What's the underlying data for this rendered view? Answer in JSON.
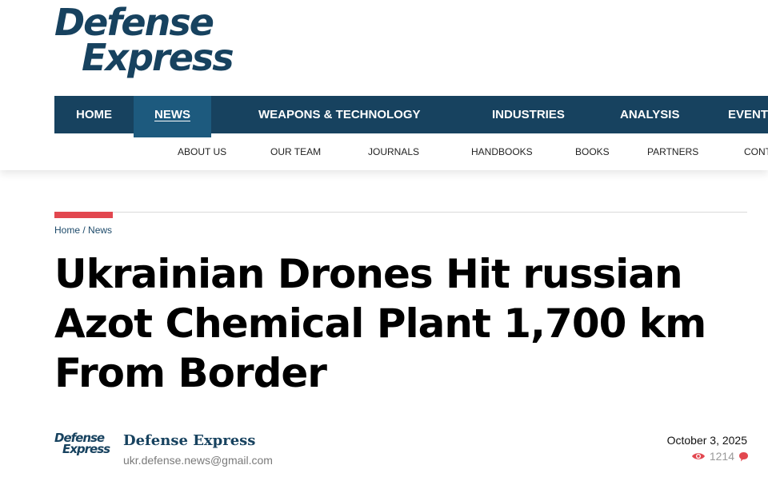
{
  "logo": {
    "line1": "Defense",
    "line2": "Express"
  },
  "main_nav": {
    "items": [
      "HOME",
      "NEWS",
      "WEAPONS & TECHNOLOGY",
      "INDUSTRIES",
      "ANALYSIS",
      "EVENT"
    ],
    "active": "NEWS"
  },
  "sub_nav": {
    "items": [
      "ABOUT US",
      "OUR TEAM",
      "JOURNALS",
      "HANDBOOKS",
      "BOOKS",
      "PARTNERS",
      "CONT"
    ]
  },
  "breadcrumb": {
    "home": "Home",
    "separator": " / ",
    "current": "News"
  },
  "article": {
    "title": "Ukrainian Drones Hit russian Azot Chemical Plant 1,700 km From Border",
    "date": "October 3, 2025",
    "views": "1214"
  },
  "author": {
    "avatar_line1": "Defense",
    "avatar_line2": "Express",
    "name": "Defense Express",
    "email": "ukr.defense.news@gmail.com"
  },
  "colors": {
    "brand": "#17425f",
    "accent": "#e2474f",
    "nav_active": "#1d5a7e"
  },
  "icons": {
    "views": "eye-icon",
    "comments": "comment-icon"
  }
}
